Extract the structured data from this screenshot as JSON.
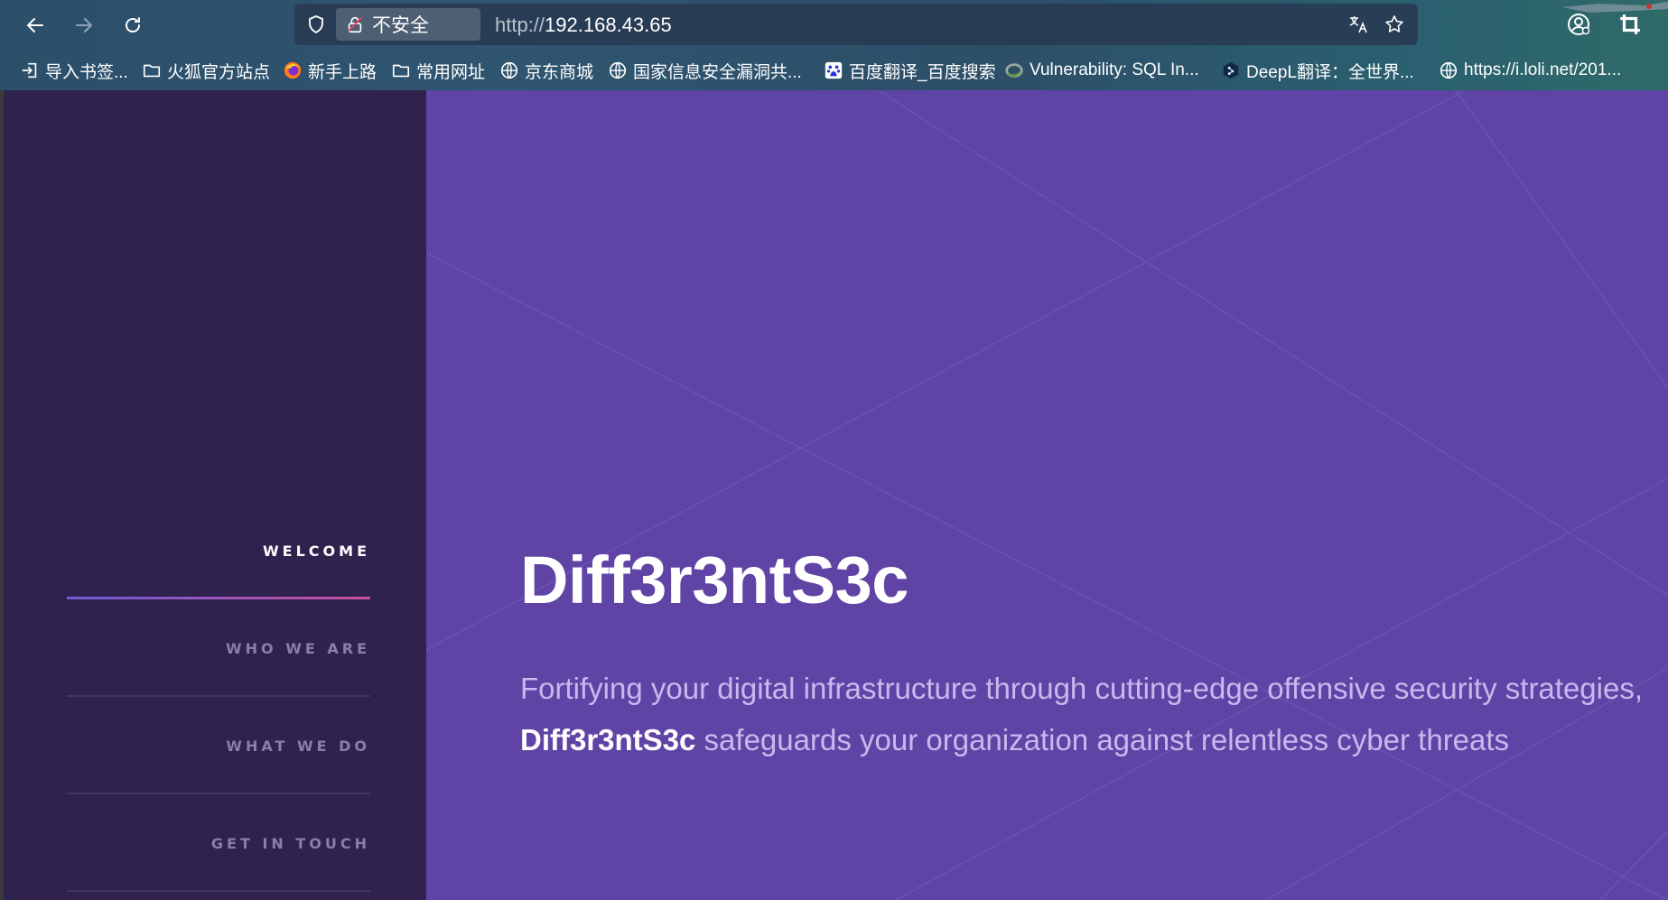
{
  "browser": {
    "security_label": "不安全",
    "url_protocol": "http://",
    "url_host": "192.168.43.65",
    "icons": [
      "back-arrow-icon",
      "forward-arrow-icon",
      "reload-icon",
      "shield-icon",
      "insecure-lock-icon",
      "translate-icon",
      "bookmark-star-icon",
      "account-icon",
      "crop-icon"
    ],
    "bookmarks": [
      {
        "label": "导入书签...",
        "icon": "import-icon"
      },
      {
        "label": "火狐官方站点",
        "icon": "folder-icon"
      },
      {
        "label": "新手上路",
        "icon": "firefox-icon"
      },
      {
        "label": "常用网址",
        "icon": "folder-icon"
      },
      {
        "label": "京东商城",
        "icon": "globe-icon"
      },
      {
        "label": "国家信息安全漏洞共...",
        "icon": "globe-icon"
      },
      {
        "label": "百度翻译_百度搜索",
        "icon": "baidu-icon"
      },
      {
        "label": "Vulnerability: SQL In...",
        "icon": "dvwa-icon"
      },
      {
        "label": "DeepL翻译：全世界...",
        "icon": "deepl-icon"
      },
      {
        "label": "https://i.loli.net/201...",
        "icon": "globe-icon"
      }
    ]
  },
  "sidebar": {
    "items": [
      {
        "label": "WELCOME",
        "active": true
      },
      {
        "label": "WHO WE ARE",
        "active": false
      },
      {
        "label": "WHAT WE DO",
        "active": false
      },
      {
        "label": "GET IN TOUCH",
        "active": false
      }
    ]
  },
  "hero": {
    "title": "Diff3r3ntS3c",
    "tagline_line1": "Fortifying your digital infrastructure through cutting-edge offensive security strategies,",
    "tagline_brand": "Diff3r3ntS3c",
    "tagline_rest": " safeguards your organization against relentless cyber threats"
  },
  "colors": {
    "sidebar_bg": "#30224e",
    "hero_bg": "#5f44a6",
    "accent_gradient_start": "#6c5cd6",
    "accent_gradient_end": "#c84fa0"
  }
}
